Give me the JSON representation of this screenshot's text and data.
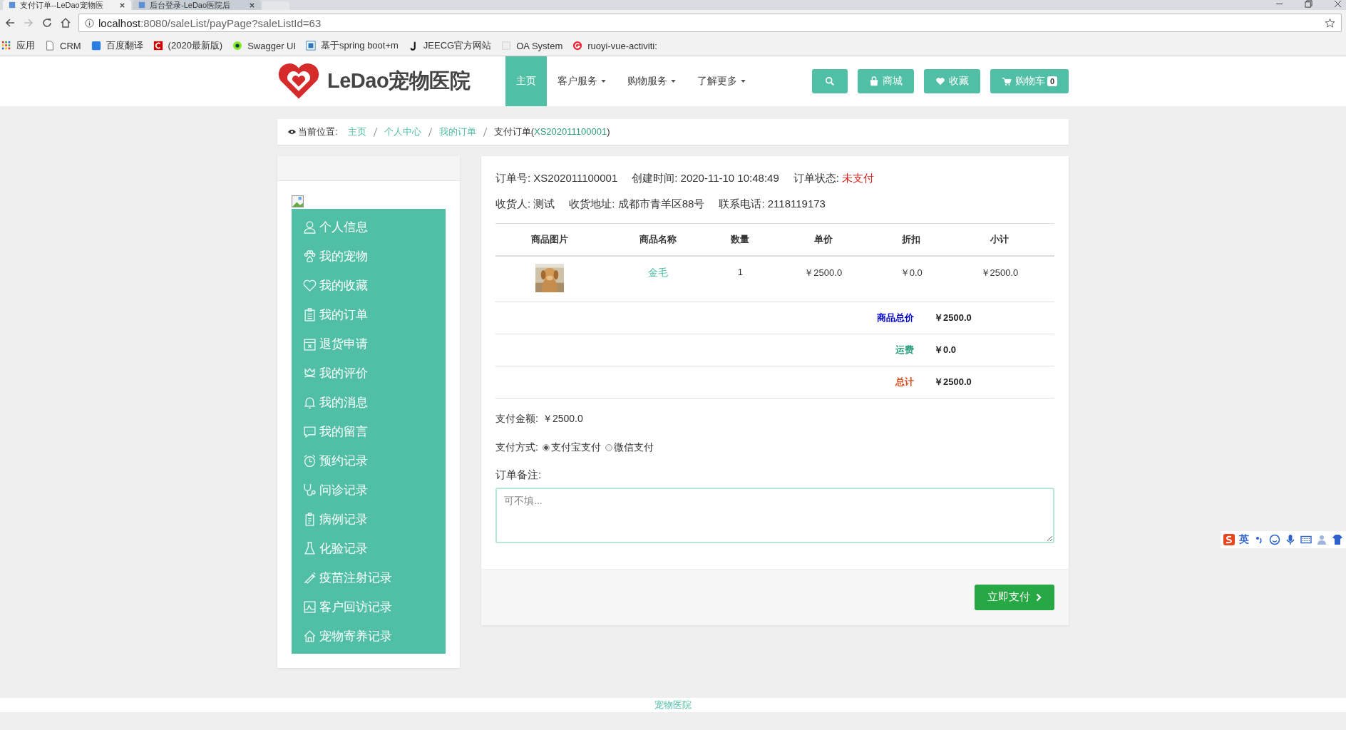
{
  "browser": {
    "tabs": [
      {
        "title": "支付订单--LeDao宠物医",
        "selected": true
      },
      {
        "title": "后台登录-LeDao医院后",
        "selected": false
      }
    ],
    "url_host": "localhost",
    "url_rest": ":8080/saleList/payPage?saleListId=63",
    "bookmarks": [
      "应用",
      "CRM",
      "百度翻译",
      "(2020最新版)",
      "Swagger UI",
      "基于spring boot+m",
      "JEECG官方网站",
      "OA System",
      "ruoyi-vue-activiti:"
    ]
  },
  "header": {
    "logo": "LeDao宠物医院",
    "nav": [
      {
        "label": "主页",
        "selected": true,
        "dropdown": false
      },
      {
        "label": "客户服务",
        "selected": false,
        "dropdown": true
      },
      {
        "label": "购物服务",
        "selected": false,
        "dropdown": true
      },
      {
        "label": "了解更多",
        "selected": false,
        "dropdown": true
      }
    ],
    "actions": [
      {
        "kind": "search"
      },
      {
        "kind": "shop",
        "label": "商城"
      },
      {
        "kind": "favorite",
        "label": "收藏"
      },
      {
        "kind": "cart",
        "label": "购物车",
        "count": "0"
      }
    ]
  },
  "breadcrumb": {
    "prefix": "当前位置:",
    "links": [
      "主页",
      "个人中心",
      "我的订单"
    ],
    "current": "支付订单(",
    "current_id": "XS202011100001",
    "current_end": ")"
  },
  "sidebar": {
    "items": [
      "个人信息",
      "我的宠物",
      "我的收藏",
      "我的订单",
      "退货申请",
      "我的评价",
      "我的消息",
      "我的留言",
      "预约记录",
      "问诊记录",
      "病例记录",
      "化验记录",
      "疫苗注射记录",
      "客户回访记录",
      "宠物寄养记录"
    ]
  },
  "order": {
    "info_lines": [
      [
        {
          "label": "订单号:",
          "value": "XS202011100001"
        },
        {
          "label": "创建时间:",
          "value": "2020-11-10 10:48:49"
        },
        {
          "label": "订单状态:",
          "value": "未支付",
          "alert": true
        }
      ],
      [
        {
          "label": "收货人:",
          "value": "测试"
        },
        {
          "label": "收货地址:",
          "value": "成都市青羊区88号"
        },
        {
          "label": "联系电话:",
          "value": "2118119173"
        }
      ]
    ],
    "table": {
      "columns": [
        "商品图片",
        "商品名称",
        "数量",
        "单价",
        "折扣",
        "小计"
      ],
      "rows": [
        {
          "name": "金毛",
          "quantity": "1",
          "price": "￥2500.0",
          "discount": "￥0.0",
          "subtotal": "￥2500.0"
        }
      ]
    },
    "summary": [
      {
        "label": "商品总价",
        "value": "￥2500.0",
        "color": "#0000cc"
      },
      {
        "label": "运费",
        "value": "￥0.0",
        "color": "#2e9e7e"
      },
      {
        "label": "总计",
        "value": "￥2500.0",
        "color": "#e0491b"
      }
    ],
    "amount": {
      "label": "支付金额:",
      "value": "￥2500.0"
    },
    "payment": {
      "label": "支付方式:",
      "options": [
        {
          "label": "支付宝支付",
          "selected": true
        },
        {
          "label": "微信支付",
          "selected": false
        }
      ]
    },
    "note": {
      "label": "订单备注:",
      "placeholder": "可不填..."
    },
    "submit": "立即支付"
  },
  "footer": "宠物医院",
  "ime": {
    "label": "英"
  }
}
